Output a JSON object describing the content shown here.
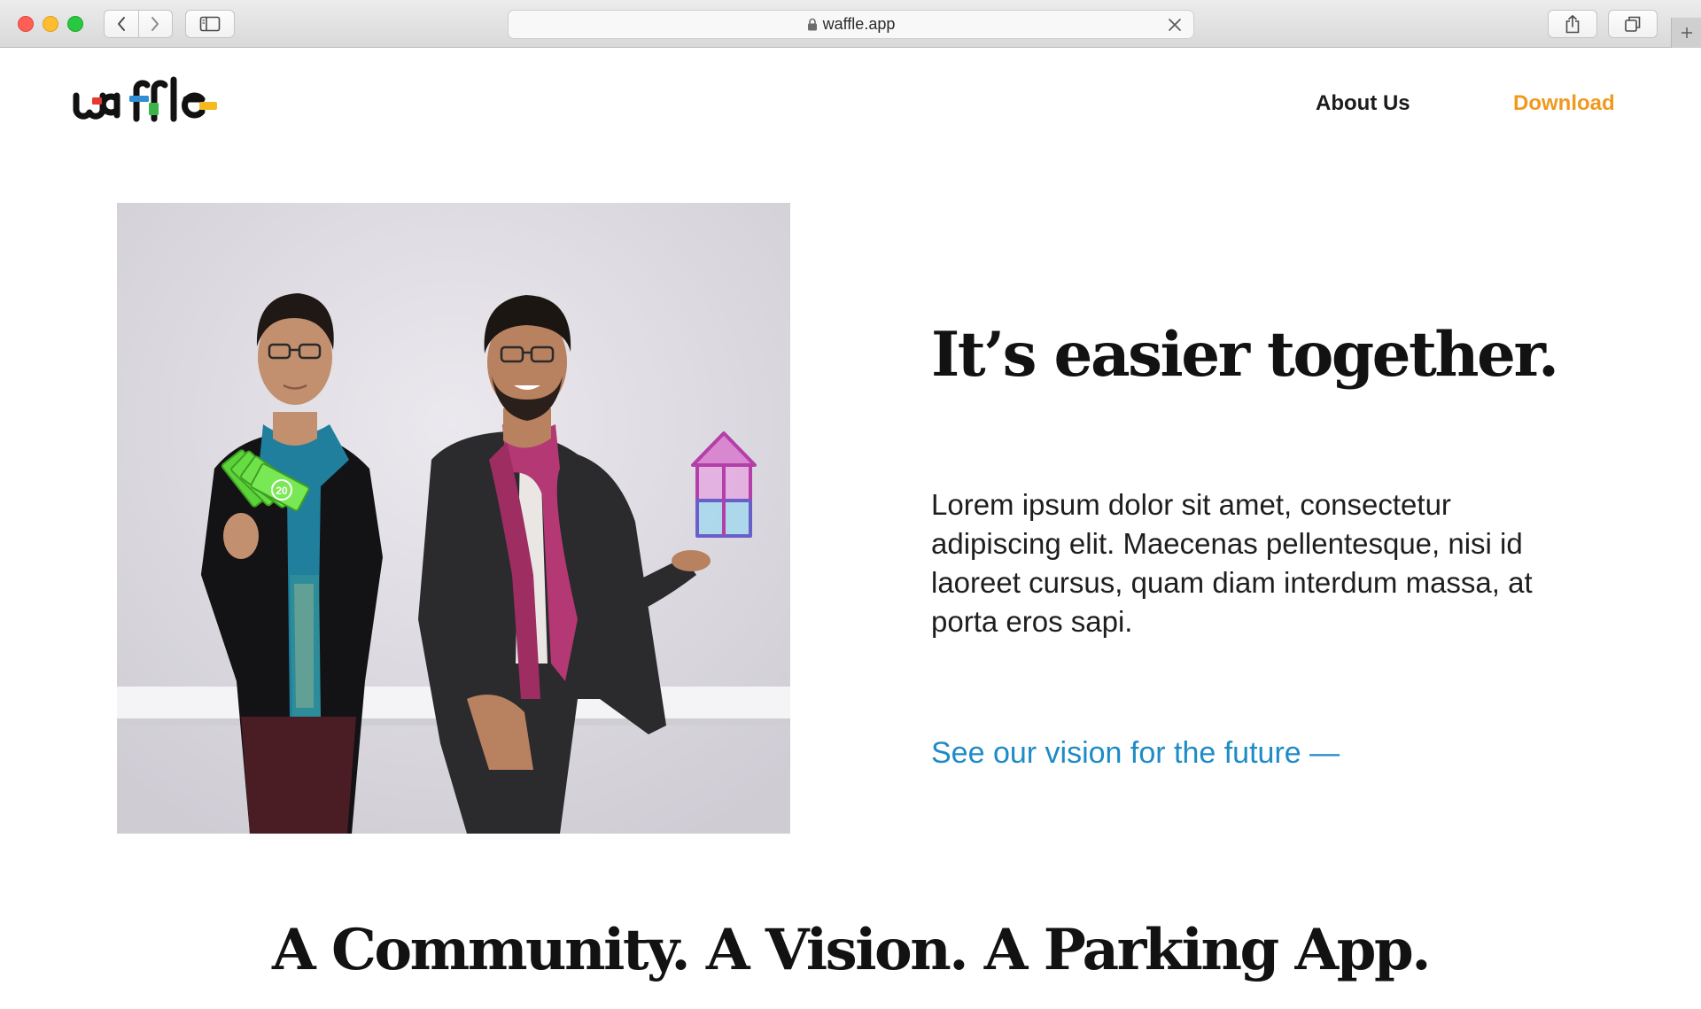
{
  "browser": {
    "url": "waffle.app"
  },
  "site": {
    "logo_text": "waffle",
    "colors": {
      "accent_orange": "#f0991e",
      "link_blue": "#1d8bc6",
      "logo_red": "#e8382f",
      "logo_blue": "#2f8fd2",
      "logo_green": "#3bb44a",
      "logo_yellow": "#f6b91e"
    }
  },
  "nav": {
    "about_label": "About Us",
    "download_label": "Download"
  },
  "hero": {
    "headline": "It’s easier together.",
    "body": "Lorem ipsum dolor sit amet, consectetur adipiscing elit. Maecenas pellentesque, nisi id laoreet cursus, quam diam interdum massa, at porta eros sapi.",
    "link": "See our vision for the future —",
    "photo_banknote_value": "20"
  },
  "section": {
    "title": "A Community. A Vision. A Parking App."
  }
}
